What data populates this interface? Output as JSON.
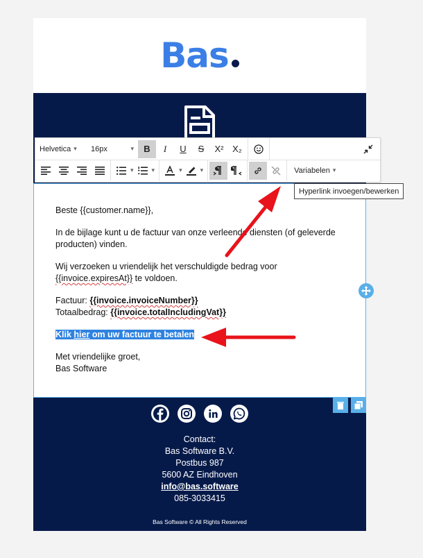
{
  "logo": {
    "text": "Bas"
  },
  "toolbar": {
    "font_family": "Helvetica",
    "font_size": "16px",
    "bold": "B",
    "italic": "I",
    "underline": "U",
    "strike": "S",
    "superscript": "X²",
    "subscript": "X₂",
    "variables": "Variabelen"
  },
  "tooltip": "Hyperlink invoegen/bewerken",
  "editor": {
    "greeting": "Beste {{customer.name}},",
    "para1": "In de bijlage kunt u de factuur van onze verleende diensten (of geleverde producten) vinden.",
    "para2_a": "Wij verzoeken u vriendelijk het verschuldigde bedrag voor ",
    "para2_var": "{{invoice.expiresAt}}",
    "para2_b": " te voldoen.",
    "invoice_label": "Factuur: ",
    "invoice_var": "{{invoice.invoiceNumber}}",
    "total_label": "Totaalbedrag: ",
    "total_var": "{{invoice.totalIncludingVat}}",
    "link_pre": "Klik ",
    "link_word": "hier",
    "link_post": " om uw factuur te betalen",
    "closing": "Met vriendelijke groet,",
    "signature": "Bas Software"
  },
  "footer": {
    "contact_title": "Contact:",
    "company": "Bas Software B.V.",
    "postbus": "Postbus 987",
    "city": "5600 AZ Eindhoven",
    "email": "info@bas.software",
    "phone": "085-3033415",
    "copyright": "Bas Software © All Rights Reserved"
  },
  "colors": {
    "brand_blue": "#3b7fe6",
    "navy": "#061a4a",
    "accent": "#5aafe8",
    "annotation": "#e8131b"
  },
  "icons": [
    "document-icon",
    "facebook-icon",
    "instagram-icon",
    "linkedin-icon",
    "whatsapp-icon",
    "trash-icon",
    "duplicate-icon",
    "move-icon",
    "link-icon",
    "unlink-icon"
  ]
}
